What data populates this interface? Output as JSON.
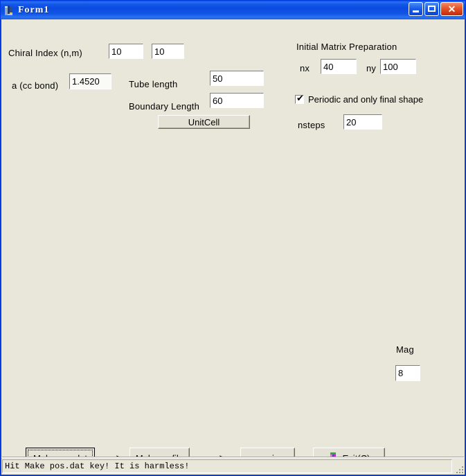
{
  "window": {
    "title": "Form1",
    "icon": "vb-form-icon",
    "controls": {
      "minimize": "minimize-button",
      "maximize": "maximize-button",
      "close": "close-button",
      "close_glyph": "✕"
    },
    "colors": {
      "titlebar_blue": "#0B4ADF",
      "form_background": "#E9E7DA",
      "border_blue": "#0A46E4",
      "close_red": "#E45528"
    }
  },
  "left_panel": {
    "chiral_index_label": "Chiral Index (n,m)",
    "chiral_n_value": "10",
    "chiral_m_value": "10",
    "a_cc_bond_label": "a (cc bond)",
    "a_cc_bond_value": "1.4520",
    "tube_length_label": "Tube length",
    "tube_length_value": "50",
    "boundary_length_label": "Boundary Length",
    "boundary_length_value": "60",
    "unitcell_button_label": "UnitCell"
  },
  "right_panel": {
    "section_title": "Initial Matrix Preparation",
    "nx_label": "nx",
    "nx_value": "40",
    "ny_label": "ny",
    "ny_value": "100",
    "periodic_checkbox_label": "Periodic and only final shape",
    "periodic_checkbox_checked": true,
    "periodic_checkbox_tick": "✔",
    "nsteps_label": "nsteps",
    "nsteps_value": "20",
    "mag_label": "Mag",
    "mag_value": "8"
  },
  "action_bar": {
    "make_pos_dat_label": "Make pos.dat",
    "arrow_1": "--->",
    "make_pv_file_label": "Make pv file",
    "arrow_2": "--->",
    "pvwin_label": "pvwin",
    "exit_label": "Exit(C)",
    "exit_icon": "exit-door-icon",
    "focused_button": "Make pos.dat"
  },
  "status_bar": {
    "message": "Hit Make pos.dat key! It is harmless!"
  }
}
